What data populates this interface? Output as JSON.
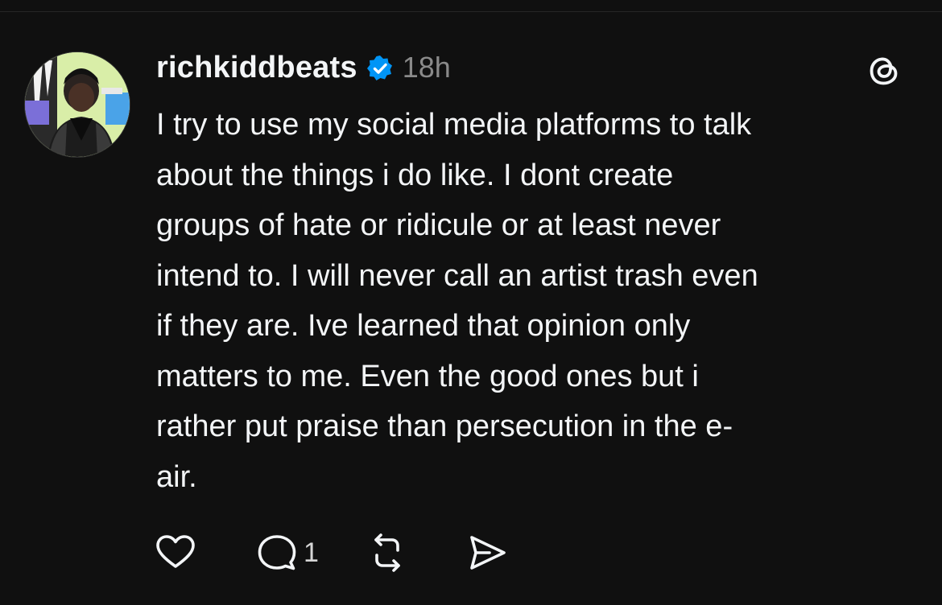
{
  "post": {
    "username": "richkiddbeats",
    "verified": true,
    "time_ago": "18h",
    "text": "I try to use my social media platforms to talk\nabout the things i do like. I dont create\ngroups of hate or ridicule or at least never\nintend to. I will never call an artist trash even\nif they are. Ive learned that opinion only\nmatters to me. Even the good ones but i\nrather put praise than persecution in the e-\nair.",
    "actions": {
      "like_icon": "heart-icon",
      "reply_icon": "comment-icon",
      "reply_count": "1",
      "repost_icon": "repost-icon",
      "share_icon": "send-icon"
    }
  },
  "colors": {
    "background": "#101010",
    "text": "#f3f5f7",
    "muted": "#8a8a8a",
    "verified_blue": "#0095f6"
  }
}
